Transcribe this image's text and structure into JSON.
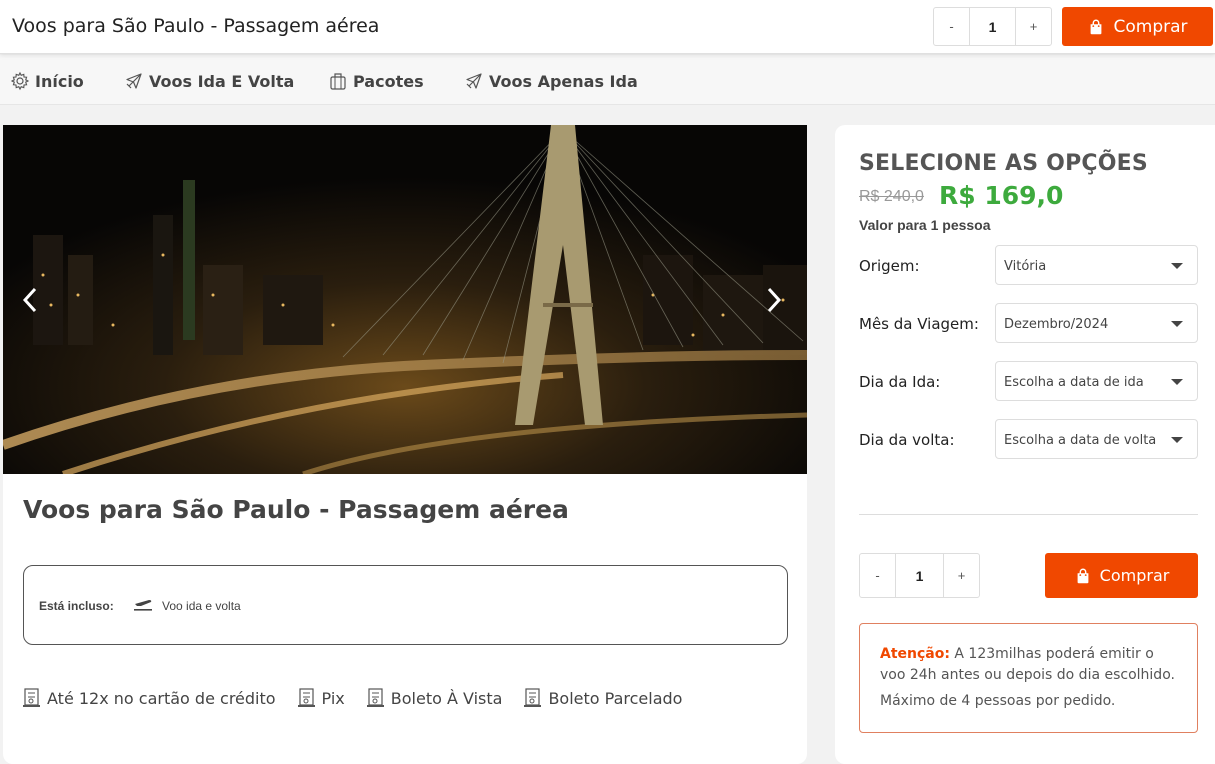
{
  "header": {
    "title": "Voos para São Paulo - Passagem aérea",
    "qty_minus": "-",
    "qty_value": "1",
    "qty_plus": "+",
    "buy_label": "Comprar"
  },
  "nav": {
    "items": [
      {
        "label": "Início",
        "icon": "gear-icon"
      },
      {
        "label": "Voos Ida E Volta",
        "icon": "plane-icon"
      },
      {
        "label": "Pacotes",
        "icon": "luggage-icon"
      },
      {
        "label": "Voos Apenas Ida",
        "icon": "plane-icon"
      }
    ]
  },
  "product": {
    "title": "Voos para São Paulo - Passagem aérea",
    "included_label": "Está incluso:",
    "included_value": "Voo ida e volta",
    "payments": [
      "Até 12x no cartão de crédito",
      "Pix",
      "Boleto À Vista",
      "Boleto Parcelado"
    ]
  },
  "options": {
    "title": "SELECIONE AS OPÇÕES",
    "price_old": "R$ 240,0",
    "price_new": "R$ 169,0",
    "per_person": "Valor para 1 pessoa",
    "fields": [
      {
        "label": "Origem:",
        "value": "Vitória"
      },
      {
        "label": "Mês da Viagem:",
        "value": "Dezembro/2024"
      },
      {
        "label": "Dia da Ida:",
        "value": "Escolha a data de ida"
      },
      {
        "label": "Dia da volta:",
        "value": "Escolha a data de volta"
      }
    ],
    "qty_minus": "-",
    "qty_value": "1",
    "qty_plus": "+",
    "buy_label": "Comprar",
    "notice_attention": "Atenção:",
    "notice_text": " A 123milhas poderá emitir o voo 24h antes ou depois do dia escolhido.",
    "notice_max": "Máximo de 4 pessoas por pedido."
  },
  "colors": {
    "accent": "#f04800",
    "price_green": "#3daa3d"
  }
}
